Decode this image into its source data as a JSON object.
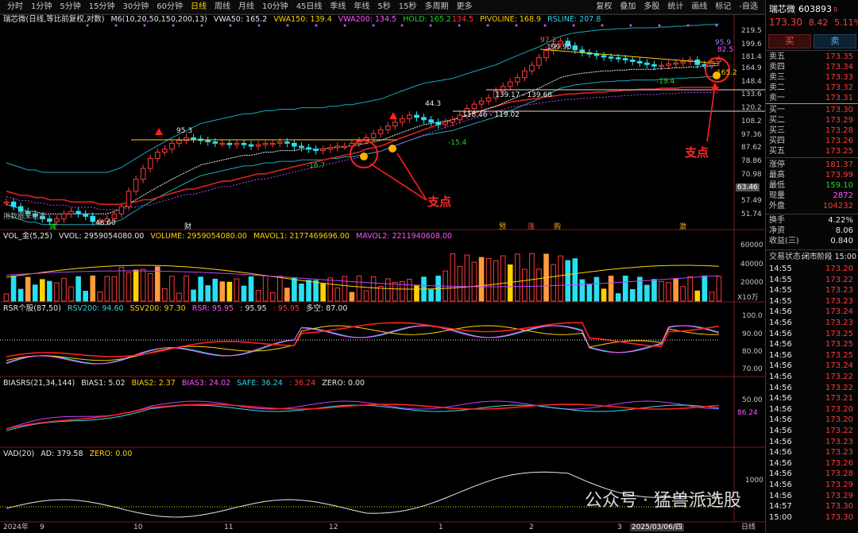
{
  "topbar": {
    "timeframes": [
      "分时",
      "1分钟",
      "5分钟",
      "15分钟",
      "30分钟",
      "60分钟",
      "日线",
      "周线",
      "月线",
      "10分钟",
      "45日线",
      "季线",
      "年线",
      "5秒",
      "15秒",
      "多周期",
      "更多"
    ],
    "active": "日线",
    "tools": [
      "复权",
      "叠加",
      "多股",
      "统计",
      "画线",
      "标记",
      "-自选"
    ]
  },
  "main_info": {
    "title": "瑞芯微(日线,等比前复权,对数)",
    "m6": "M6(10,20,50,150,200,13)",
    "vwa50": "VWA50: 165.2",
    "vwa150": "VWA150: 139.4",
    "vwa200": "VWA200: 134.5",
    "hold": "HOLD: 165.2",
    "hold2": "134.5",
    "pivoline": "PIVOLINE: 168.9",
    "rsline": "RSLINE: 207.8"
  },
  "price_axis": [
    "219.5",
    "199.6",
    "181.4",
    "164.9",
    "148.4",
    "133.6",
    "120.2",
    "108.2",
    "97.36",
    "87.62",
    "78.86",
    "70.98",
    "63.46",
    "57.49",
    "51.74"
  ],
  "price_labels": {
    "h1": "95.3",
    "h2": "44.3",
    "h3": "97.3",
    "h4": "199.90",
    "h5": "95.9",
    "h6": "82.5",
    "l1": "48.60",
    "l2": "-16.7",
    "l3": "-15.4",
    "l4": "-19.4",
    "cur": "165.2",
    "r1": "118.46 - 119.02",
    "r2": "139.17 - 139.68",
    "left_watermark": "用数据来说话"
  },
  "events": [
    "减",
    "财",
    "预",
    "涨",
    "购",
    "激"
  ],
  "vol_info": {
    "title": "VOL_金(5,25)",
    "vvol": "VVOL: 2959054080.00",
    "volume": "VOLUME: 2959054080.00",
    "mavol1": "MAVOL1: 2177469696.00",
    "mavol2": "MAVOL2: 2211940608.00",
    "axis": [
      "60000",
      "40000",
      "20000"
    ],
    "unit": "X10万"
  },
  "rsr_info": {
    "title": "RSR个股(87,50)",
    "rsv200": "RSV200: 94.60",
    "ssv200": "SSV200: 97.30",
    "rsr": "RSR: 95.95",
    "v1": ": 95.95",
    "v2": ": 95.95",
    "dk": "多空: 87.00",
    "axis": [
      "100.0",
      "90.00",
      "80.00",
      "70.00"
    ]
  },
  "bias_info": {
    "title": "BIASRS(21,34,144)",
    "b1": "BIAS1: 5.02",
    "b2": "BIAS2: 2.37",
    "b3": "BIAS3: 24.02",
    "safe": "SAFE: 36.24",
    "v": ": 36.24",
    "zero": "ZERO: 0.00",
    "axis": [
      "50.00",
      "86.24"
    ]
  },
  "vad_info": {
    "title": "VAD(20)",
    "ad": "AD: 379.58",
    "zero": "ZERO: 0.00",
    "axis": [
      "1000"
    ]
  },
  "time_axis": [
    "2024年",
    "9",
    "10",
    "11",
    "12",
    "1",
    "2",
    "3",
    "2025/03/06/四"
  ],
  "bottom_right": "日线",
  "annotation": "支点",
  "watermark": "公众号 · 猛兽派选股",
  "side": {
    "name": "瑞芯微",
    "code": "603893",
    "r": "R",
    "price": "173.30",
    "chg": "8.42",
    "pct": "5.11%",
    "buy_btn": "买",
    "sell_btn": "卖",
    "asks": [
      [
        "卖五",
        "173.35"
      ],
      [
        "卖四",
        "173.34"
      ],
      [
        "卖三",
        "173.33"
      ],
      [
        "卖二",
        "173.32"
      ],
      [
        "卖一",
        "173.31"
      ]
    ],
    "bids": [
      [
        "买一",
        "173.30"
      ],
      [
        "买二",
        "173.29"
      ],
      [
        "买三",
        "173.28"
      ],
      [
        "买四",
        "173.26"
      ],
      [
        "买五",
        "173.25"
      ]
    ],
    "stats": [
      [
        "涨停",
        "181.37",
        "red"
      ],
      [
        "最高",
        "173.99",
        "red"
      ],
      [
        "最低",
        "159.10",
        "grn"
      ],
      [
        "现量",
        "2872",
        "mag"
      ],
      [
        "外盘",
        "104232",
        "red"
      ]
    ],
    "stats2": [
      [
        "换手",
        "4.22%",
        "wht"
      ],
      [
        "净资",
        "8.06",
        "wht"
      ],
      [
        "收益(三)",
        "0.840",
        "wht"
      ]
    ],
    "status_label": "交易状态:",
    "status": "闭市阶段 15:00",
    "ticks": [
      [
        "14:55",
        "173.20"
      ],
      [
        "14:55",
        "173.22"
      ],
      [
        "14:55",
        "173.23"
      ],
      [
        "14:55",
        "173.23"
      ],
      [
        "14:56",
        "173.24"
      ],
      [
        "14:56",
        "173.23"
      ],
      [
        "14:56",
        "173.25"
      ],
      [
        "14:56",
        "173.25"
      ],
      [
        "14:56",
        "173.25"
      ],
      [
        "14:56",
        "173.24"
      ],
      [
        "14:56",
        "173.22"
      ],
      [
        "14:56",
        "173.22"
      ],
      [
        "14:56",
        "173.21"
      ],
      [
        "14:56",
        "173.20"
      ],
      [
        "14:56",
        "173.20"
      ],
      [
        "14:56",
        "173.22"
      ],
      [
        "14:56",
        "173.23"
      ],
      [
        "14:56",
        "173.23"
      ],
      [
        "14:56",
        "173.26"
      ],
      [
        "14:56",
        "173.28"
      ],
      [
        "14:56",
        "173.29"
      ],
      [
        "14:56",
        "173.29"
      ],
      [
        "14:57",
        "173.30"
      ],
      [
        "15:00",
        "173.30"
      ]
    ]
  },
  "chart_data": {
    "type": "candlestick",
    "title": "瑞芯微(日线,等比前复权,对数)",
    "xlabel": "",
    "ylabel": "",
    "ylim": [
      51.74,
      219.5
    ],
    "x_ticks": [
      "2024年",
      "9",
      "10",
      "11",
      "12",
      "1",
      "2",
      "3",
      "2025/03/06/四"
    ],
    "series": [
      {
        "name": "close",
        "values": [
          57,
          55,
          53,
          52,
          51,
          50,
          49,
          50,
          52,
          53,
          52,
          51,
          49,
          49,
          50,
          52,
          55,
          62,
          68,
          74,
          80,
          84,
          86,
          90,
          92,
          94,
          93,
          92,
          91,
          90,
          90,
          89,
          90,
          89,
          88,
          89,
          90,
          90,
          91,
          90,
          88,
          87,
          86,
          85,
          86,
          87,
          88,
          88,
          90,
          92,
          94,
          97,
          100,
          103,
          106,
          109,
          112,
          110,
          108,
          106,
          104,
          106,
          108,
          112,
          118,
          122,
          125,
          128,
          135,
          140,
          145,
          150,
          158,
          165,
          175,
          185,
          195,
          199,
          192,
          186,
          182,
          180,
          178,
          176,
          175,
          174,
          172,
          170,
          168,
          166,
          164,
          165,
          167,
          168,
          170,
          172,
          166,
          165,
          170,
          173
        ]
      },
      {
        "name": "VWA50",
        "values": [
          56,
          55,
          54,
          53,
          53,
          52,
          52,
          52,
          52,
          52,
          52,
          52,
          52,
          52,
          52,
          53,
          54,
          56,
          58,
          60,
          62,
          64,
          66,
          68,
          70,
          72,
          74,
          76,
          77,
          78,
          79,
          80,
          81,
          82,
          82,
          83,
          84,
          84,
          85,
          85,
          85,
          86,
          86,
          86,
          86,
          87,
          87,
          88,
          88,
          89,
          90,
          91,
          92,
          94,
          96,
          98,
          100,
          102,
          104,
          105,
          106,
          107,
          108,
          110,
          112,
          114,
          116,
          118,
          120,
          123,
          126,
          129,
          132,
          135,
          138,
          142,
          146,
          150,
          152,
          154,
          155,
          156,
          157,
          158,
          158,
          159,
          159,
          160,
          160,
          160,
          160,
          161,
          161,
          162,
          162,
          163,
          163,
          164,
          164,
          165
        ]
      },
      {
        "name": "VWA150",
        "values": [
          62,
          61,
          60,
          60,
          59,
          59,
          58,
          58,
          58,
          57,
          57,
          57,
          57,
          56,
          56,
          56,
          56,
          57,
          57,
          58,
          58,
          59,
          60,
          61,
          62,
          63,
          63,
          64,
          65,
          66,
          67,
          67,
          68,
          69,
          70,
          71,
          71,
          72,
          73,
          74,
          75,
          76,
          77,
          78,
          79,
          80,
          81,
          82,
          83,
          84,
          86,
          87,
          88,
          90,
          92,
          94,
          96,
          98,
          100,
          102,
          104,
          106,
          108,
          110,
          112,
          114,
          116,
          118,
          120,
          122,
          124,
          125,
          126,
          127,
          128,
          129,
          130,
          131,
          132,
          132,
          133,
          133,
          134,
          134,
          135,
          135,
          136,
          136,
          137,
          137,
          137,
          138,
          138,
          138,
          139,
          139,
          139,
          139,
          139,
          139
        ]
      }
    ]
  }
}
